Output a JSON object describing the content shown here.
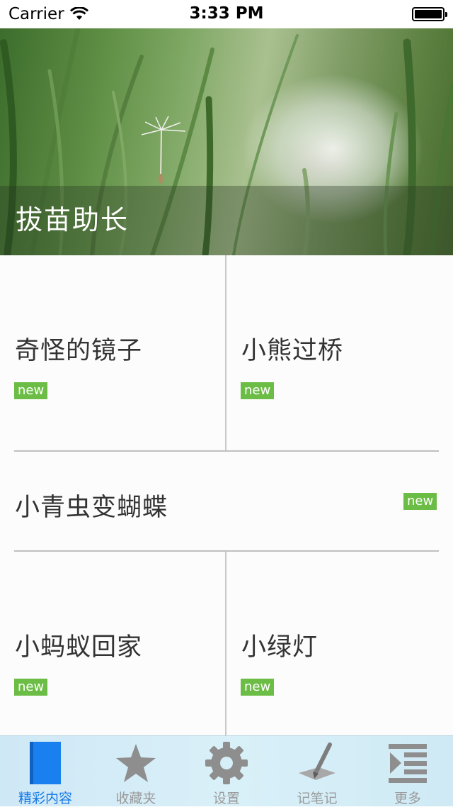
{
  "status": {
    "carrier": "Carrier",
    "time": "3:33 PM"
  },
  "hero": {
    "title": "拔苗助长"
  },
  "stories": [
    {
      "title": "奇怪的镜子",
      "badge": "new"
    },
    {
      "title": "小熊过桥",
      "badge": "new"
    },
    {
      "title": "小青虫变蝴蝶",
      "badge": "new"
    },
    {
      "title": "小蚂蚁回家",
      "badge": "new"
    },
    {
      "title": "小绿灯",
      "badge": "new"
    }
  ],
  "tabs": [
    {
      "label": "精彩内容",
      "icon": "book-icon",
      "active": true
    },
    {
      "label": "收藏夹",
      "icon": "star-icon"
    },
    {
      "label": "设置",
      "icon": "gear-icon"
    },
    {
      "label": "记笔记",
      "icon": "pen-icon"
    },
    {
      "label": "更多",
      "icon": "more-list-icon"
    }
  ],
  "colors": {
    "badge": "#6cbd45",
    "tab_active": "#1478e6",
    "tab_inactive": "#9a9a9a"
  }
}
